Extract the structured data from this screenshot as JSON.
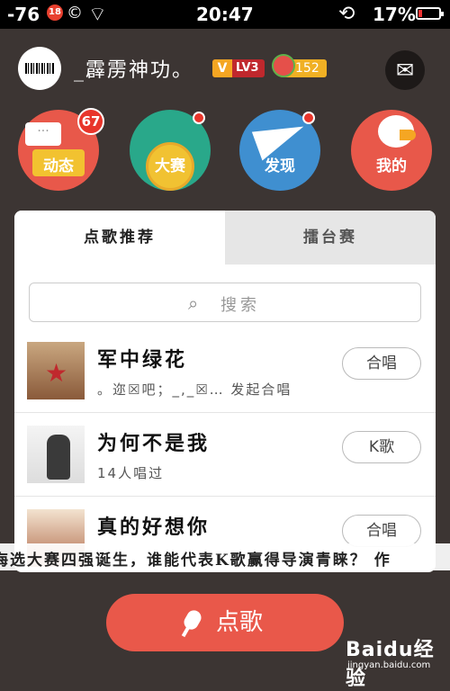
{
  "status_bar": {
    "signal": "-76",
    "rating_icon": "18",
    "copyright_icon": "©",
    "time": "20:47",
    "battery": "17%",
    "battery_level": 0.17
  },
  "profile": {
    "username": "_霹雳神功。",
    "level": "LV3",
    "flowers": "152"
  },
  "categories": [
    {
      "label": "动态",
      "badge": "67",
      "color": "#e8584a"
    },
    {
      "label": "大赛",
      "color": "#29a88a"
    },
    {
      "label": "发现",
      "color": "#3f8fd0"
    },
    {
      "label": "我的",
      "color": "#e8584a"
    }
  ],
  "tabs": [
    {
      "label": "点歌推荐"
    },
    {
      "label": "擂台赛"
    }
  ],
  "search": {
    "placeholder": "搜索"
  },
  "songs": [
    {
      "title": "军中绿花",
      "sub": "。迩☒吧；_,_☒… 发起合唱",
      "action": "合唱"
    },
    {
      "title": "为何不是我",
      "sub": "14人唱过",
      "action": "K歌"
    },
    {
      "title": "真的好想你",
      "sub": "",
      "action": "合唱"
    }
  ],
  "ticker": "海选大赛四强诞生，谁能代表K歌赢得导演青睐？   作",
  "main_button": {
    "label": "点歌"
  },
  "watermark": {
    "brand": "Baidu经验",
    "url": "jingyan.baidu.com"
  }
}
